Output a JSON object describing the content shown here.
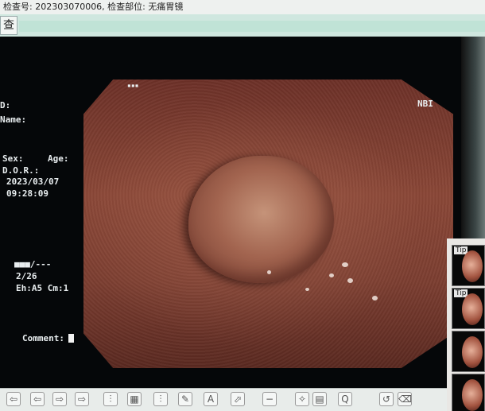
{
  "header": {
    "exam_line": "检查号: 202303070006, 检查部位: 无痛胃镜"
  },
  "tab": {
    "label": "查"
  },
  "osd": {
    "id_label": "D:",
    "name_label": "Name:",
    "sex_label": "Sex:",
    "age_label": "Age:",
    "dob_label": "D.O.R.:",
    "date": "2023/03/07",
    "time": "09:28:09",
    "mode": "NBI",
    "level_bar": "■■■/---",
    "frame": "2/26",
    "params": "Eh:A5 Cm:1",
    "comment_label": "Comment:",
    "small_mark": "▪▪▪"
  },
  "thumbnails": [
    {
      "label": "Tip"
    },
    {
      "label": "Tip"
    },
    {
      "label": ""
    },
    {
      "label": ""
    }
  ],
  "toolbar": {
    "icons": [
      "arrow-left-icon",
      "arrow-left-icon",
      "arrow-right-icon",
      "arrow-right-icon",
      "vertical-measure-icon",
      "image-icon",
      "vertical-measure-icon",
      "pen-icon",
      "text-icon",
      "arrow-icon",
      "minus-icon",
      "zoom-icon",
      "document-icon",
      "magnify-icon",
      "undo-icon",
      "erase-icon"
    ],
    "glyphs": [
      "⇦",
      "⇦",
      "⇨",
      "⇨",
      "⫶",
      "▦",
      "⫶",
      "✎",
      "A",
      "⬀",
      "−",
      "✧",
      "▤",
      "Q",
      "↺",
      "⌫"
    ]
  }
}
